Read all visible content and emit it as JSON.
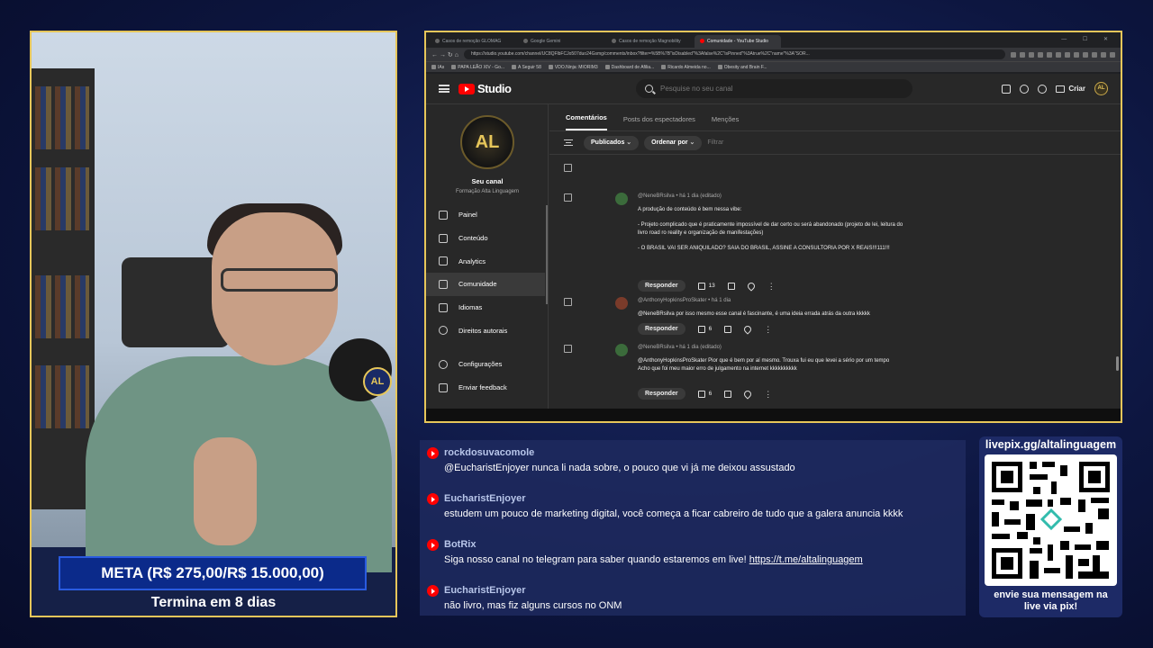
{
  "stream": {
    "goal_text": "META (R$ 275,00/R$ 15.000,00)",
    "ends_text": "Termina em 8 dias",
    "mic_logo": "AL"
  },
  "browser": {
    "tabs": [
      {
        "label": "Casos de remoção GLOMAG",
        "active": false
      },
      {
        "label": "Google Gemini",
        "active": false
      },
      {
        "label": "Casos de remoção Magnobility",
        "active": false
      },
      {
        "label": "Comunidade - YouTube Studio",
        "active": true
      }
    ],
    "url": "https://studio.youtube.com/channel/UC8QFlbFCJo507duo24Gsmg/comments/inbox?filter=%5B%7B\"isDisabled\"%3Afalse%2C\"isPinned\"%3Atrue%2C\"name\"%3A\"SOR...",
    "bookmarks": [
      "IAs",
      "PAPA LEÃO XIV - Go...",
      "A Seguir 58",
      "VDO.Ninja: MIORIM3",
      "Dashboard de Afilia...",
      "Ricardo Almeida no...",
      "Obesity and Brain F..."
    ]
  },
  "studio": {
    "brand": "Studio",
    "search_placeholder": "Pesquise no seu canal",
    "create_label": "Criar",
    "channel_title": "Seu canal",
    "channel_sub": "Formação Alta Linguagem",
    "channel_logo": "AL",
    "menu": [
      {
        "label": "Painel",
        "active": false
      },
      {
        "label": "Conteúdo",
        "active": false
      },
      {
        "label": "Analytics",
        "active": false
      },
      {
        "label": "Comunidade",
        "active": true
      },
      {
        "label": "Idiomas",
        "active": false
      },
      {
        "label": "Direitos autorais",
        "active": false
      }
    ],
    "menu_bottom": [
      {
        "label": "Configurações"
      },
      {
        "label": "Enviar feedback"
      }
    ],
    "content_tabs": [
      {
        "label": "Comentários",
        "active": true
      },
      {
        "label": "Posts dos espectadores",
        "active": false
      },
      {
        "label": "Menções",
        "active": false
      }
    ],
    "filter_chips": [
      "Publicados",
      "Ordenar por"
    ],
    "filter_placeholder": "Filtrar",
    "comments": [
      {
        "author": "@NeneBRsilva",
        "time": "há 1 dia (editado)",
        "lines": [
          "A produção de conteúdo é bem nessa vibe:",
          "- Projeto complicado que é praticamente impossível de dar certo ou será abandonado (projeto de lei, leitura do livro road ro reality e organização de manifestações)",
          "- O BRASIL VAI SER ANIQUILADO? SAIA DO BRASIL, ASSINE A CONSULTORIA POR X REAIS!!!111!!!"
        ],
        "reply_label": "Responder",
        "likes": "13"
      },
      {
        "author": "@AnthonyHopkinsProSkater",
        "time": "há 1 dia",
        "lines": [
          "@NeneBRsilva por isso mesmo esse canal é fascinante, é uma ideia errada atrás da outra kkkkk"
        ],
        "reply_label": "Responder",
        "likes": "6"
      },
      {
        "author": "@NeneBRsilva",
        "time": "há 1 dia (editado)",
        "lines": [
          "@AnthonyHopkinsProSkater Pior que é bem por aí mesmo. Trouxa fui eu que levei a sério por um tempo",
          "Acho que foi meu maior erro de julgamento na internet kkkkkkkkkk"
        ],
        "reply_label": "Responder",
        "likes": "6"
      }
    ]
  },
  "chat": [
    {
      "user": "rockdosuvacomole",
      "text": "@EucharistEnjoyer nunca li nada sobre, o pouco que vi já me deixou assustado"
    },
    {
      "user": "EucharistEnjoyer",
      "text": "estudem um pouco de marketing digital, você começa a ficar cabreiro de tudo que a galera anuncia kkkk"
    },
    {
      "user": "BotRix",
      "text": "Siga nosso canal no telegram para saber quando estaremos em live! ",
      "link": "https://t.me/altalinguagem"
    },
    {
      "user": "EucharistEnjoyer",
      "text": "não livro, mas fiz alguns cursos no ONM"
    }
  ],
  "pix": {
    "header": "livepix.gg/altalinguagem",
    "footer_line1": "envie sua mensagem na",
    "footer_line2": "live via pix!"
  }
}
